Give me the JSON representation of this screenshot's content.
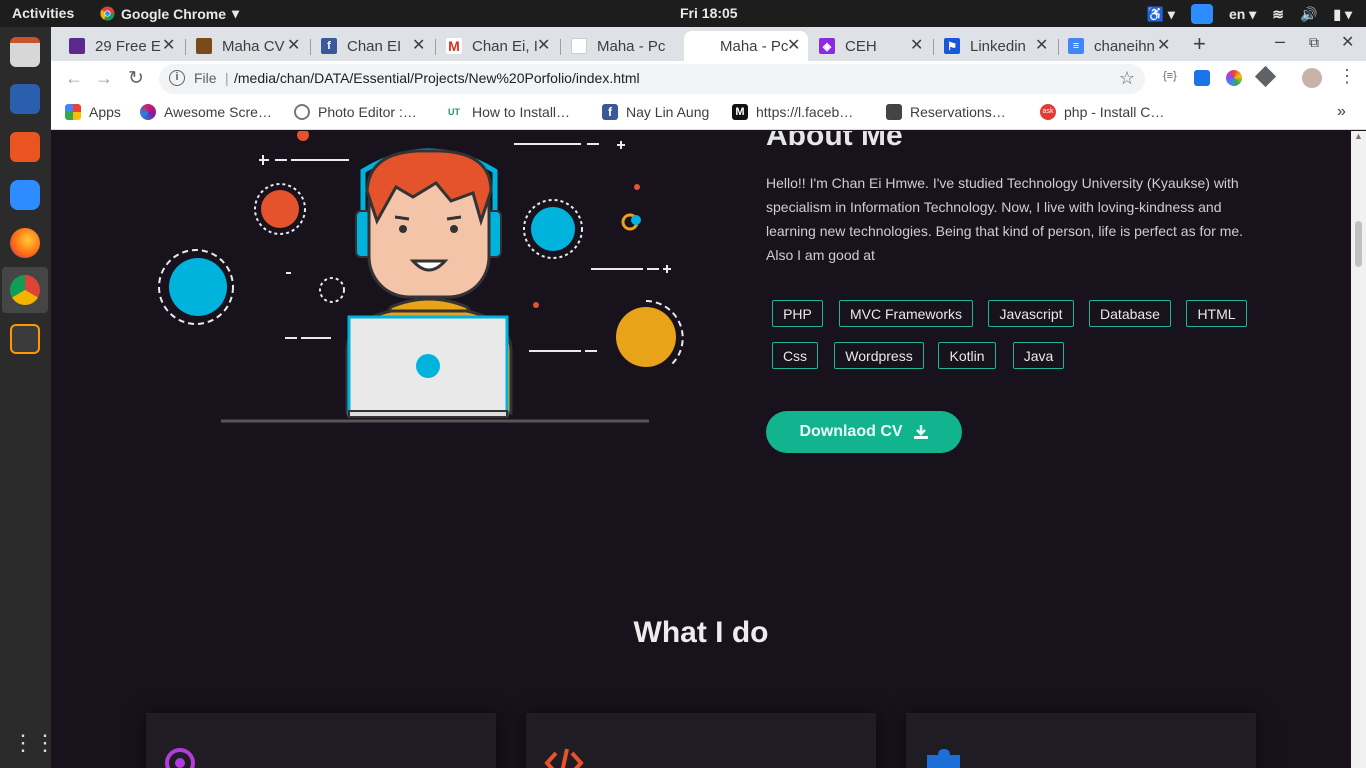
{
  "system": {
    "activities": "Activities",
    "app_name": "Google Chrome",
    "clock": "Fri 18:05",
    "lang": "en"
  },
  "tabs": [
    {
      "title": "29 Free E",
      "icon": "colorlib-icon",
      "color": "#5a2a8c"
    },
    {
      "title": "Maha CV",
      "icon": "photo-icon",
      "color": "#7a4a1a"
    },
    {
      "title": "Chan EI",
      "icon": "facebook-icon",
      "color": "#3b5998"
    },
    {
      "title": "Chan Ei, I",
      "icon": "gmail-icon",
      "color": "#d93025"
    },
    {
      "title": "Maha - Pc",
      "icon": "blank-page-icon",
      "color": "#ffffff"
    },
    {
      "title": "Maha - Pc",
      "icon": "blank-page-icon",
      "color": "#ffffff"
    },
    {
      "title": "CEH",
      "icon": "codepen-icon",
      "color": "#8a2be2"
    },
    {
      "title": "Linkedin",
      "icon": "flag-icon",
      "color": "#1a56db"
    },
    {
      "title": "chaneihn",
      "icon": "docs-icon",
      "color": "#4285f4"
    }
  ],
  "omnibox": {
    "scheme": "File",
    "url": "/media/chan/DATA/Essential/Projects/New%20Porfolio/index.html"
  },
  "bookmarks": [
    {
      "label": "Apps",
      "icon": "apps-grid-icon",
      "color": "#ea4335"
    },
    {
      "label": "Awesome Scre…",
      "icon": "awesome-screenshot-icon",
      "color": "#d81b60"
    },
    {
      "label": "Photo Editor :…",
      "icon": "photo-editor-icon",
      "color": "#777777"
    },
    {
      "label": "How to Install…",
      "icon": "ut-icon",
      "color": "#2a8f6a"
    },
    {
      "label": "Nay Lin Aung",
      "icon": "facebook-icon",
      "color": "#3b5998"
    },
    {
      "label": "https://l.faceb…",
      "icon": "medium-icon",
      "color": "#111111"
    },
    {
      "label": "Reservations…",
      "icon": "cube-icon",
      "color": "#444444"
    },
    {
      "label": "php - Install C…",
      "icon": "ask-icon",
      "color": "#e53935"
    }
  ],
  "about": {
    "title": "About Me",
    "text": "Hello!! I'm Chan Ei Hmwe. I've studied Technology University (Kyaukse) with specialism in Information Technology. Now, I live with loving-kindness and learning new technologies. Being that kind of person, life is perfect as for me. Also I am good at",
    "skills": [
      "PHP",
      "MVC Frameworks",
      "Javascript",
      "Database",
      "HTML",
      "Css",
      "Wordpress",
      "Kotlin",
      "Java"
    ],
    "cv_button": "Downlaod CV"
  },
  "what_i_do": {
    "title": "What I do"
  },
  "colors": {
    "accent": "#12b38f",
    "page_bg": "#18121d"
  }
}
